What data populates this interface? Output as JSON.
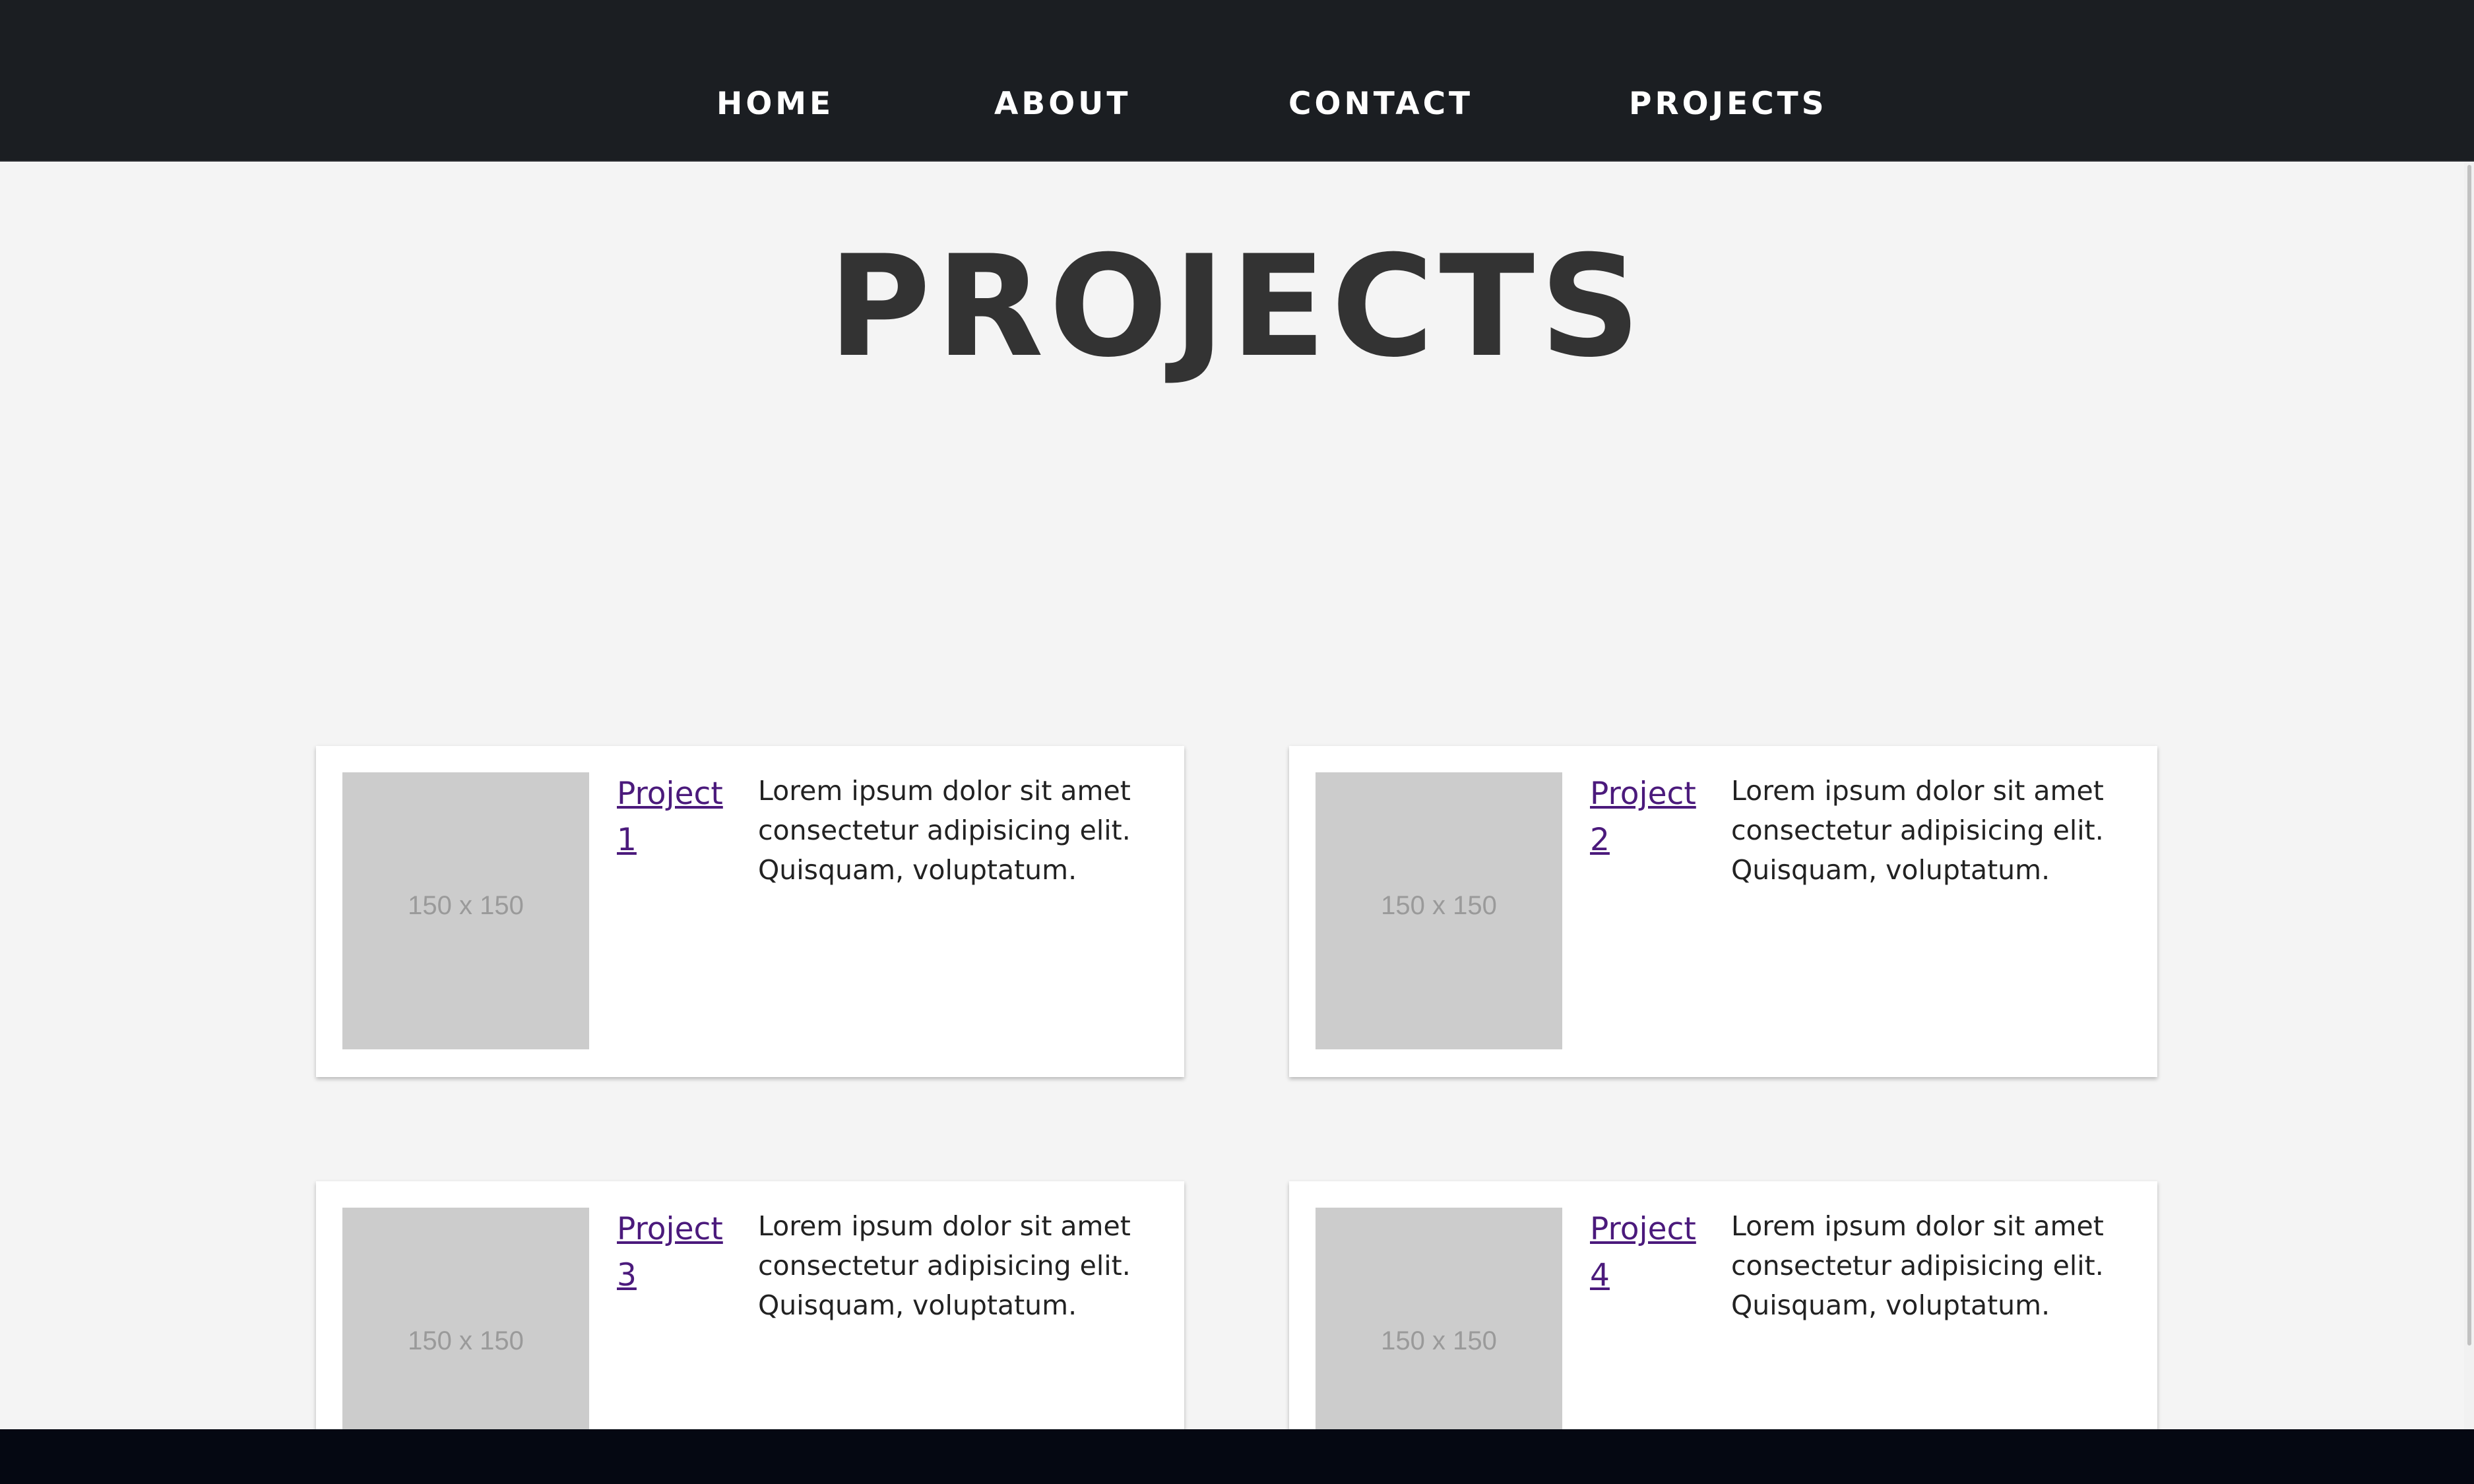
{
  "nav": {
    "items": [
      {
        "label": "HOME"
      },
      {
        "label": "ABOUT"
      },
      {
        "label": "CONTACT"
      },
      {
        "label": "PROJECTS"
      }
    ]
  },
  "main": {
    "title": "PROJECTS",
    "projects": [
      {
        "link": "Project 1",
        "image_label": "150 x 150",
        "description": "Lorem ipsum dolor sit amet consectetur adipisicing elit. Quisquam, voluptatum."
      },
      {
        "link": "Project 2",
        "image_label": "150 x 150",
        "description": "Lorem ipsum dolor sit amet consectetur adipisicing elit. Quisquam, voluptatum."
      },
      {
        "link": "Project 3",
        "image_label": "150 x 150",
        "description": "Lorem ipsum dolor sit amet consectetur adipisicing elit. Quisquam, voluptatum."
      },
      {
        "link": "Project 4",
        "image_label": "150 x 150",
        "description": "Lorem ipsum dolor sit amet consectetur adipisicing elit. Quisquam, voluptatum."
      }
    ]
  },
  "colors": {
    "navbar_bg": "#1b1e22",
    "page_bg": "#f4f4f4",
    "link": "#4b1a7c",
    "footer_bg": "#050812"
  }
}
